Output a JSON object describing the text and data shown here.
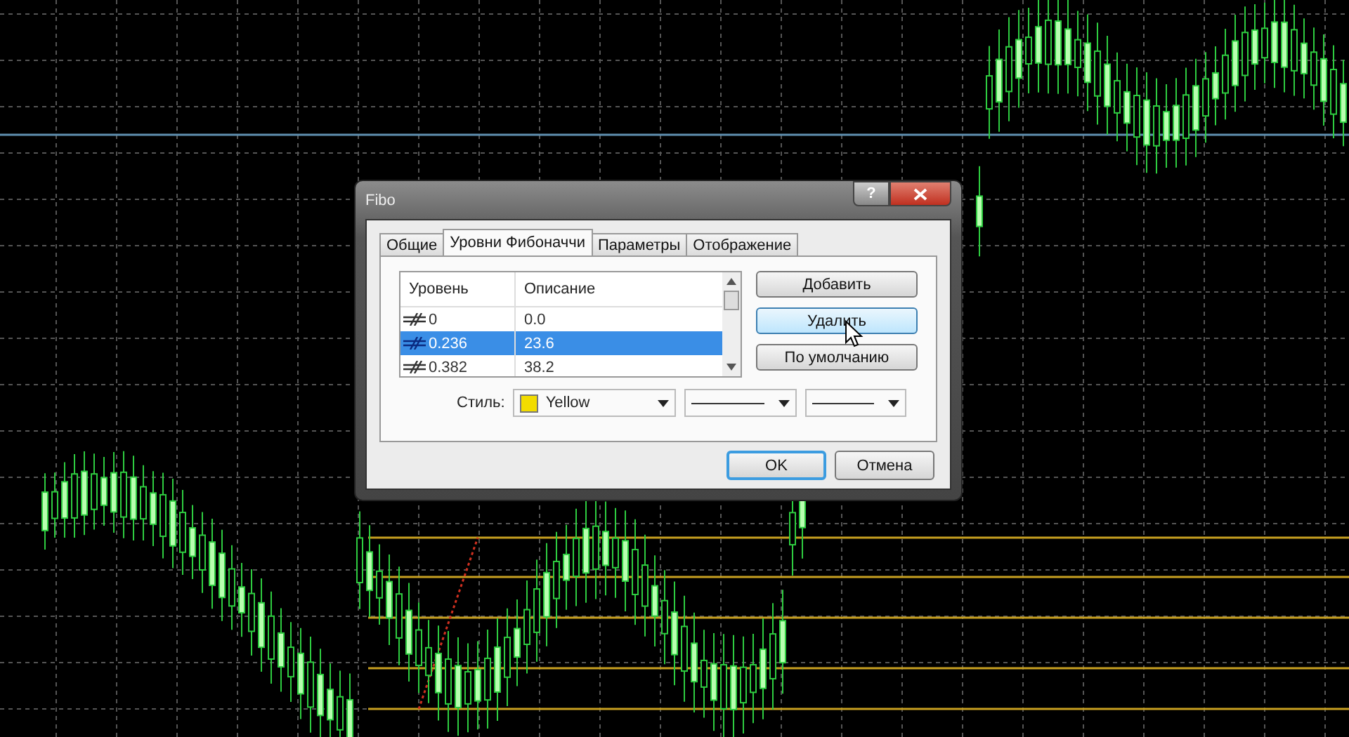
{
  "window": {
    "title": "Fibo",
    "help_button": "?"
  },
  "tabs": [
    {
      "label": "Общие",
      "selected": false
    },
    {
      "label": "Уровни Фибоначчи",
      "selected": true
    },
    {
      "label": "Параметры",
      "selected": false
    },
    {
      "label": "Отображение",
      "selected": false
    }
  ],
  "levels": {
    "columns": [
      "Уровень",
      "Описание"
    ],
    "rows": [
      {
        "level": "0",
        "description": "0.0",
        "selected": false
      },
      {
        "level": "0.236",
        "description": "23.6",
        "selected": true
      },
      {
        "level": "0.382",
        "description": "38.2",
        "selected": false
      }
    ]
  },
  "side_buttons": [
    {
      "label": "Добавить",
      "hovered": false
    },
    {
      "label": "Удалить",
      "hovered": true
    },
    {
      "label": "По умолчанию",
      "hovered": false
    }
  ],
  "style": {
    "label": "Стиль:",
    "color_name": "Yellow",
    "color": "#f2dc00"
  },
  "buttons": [
    {
      "label": "OK",
      "default": true
    },
    {
      "label": "Отмена",
      "default": false
    }
  ]
}
